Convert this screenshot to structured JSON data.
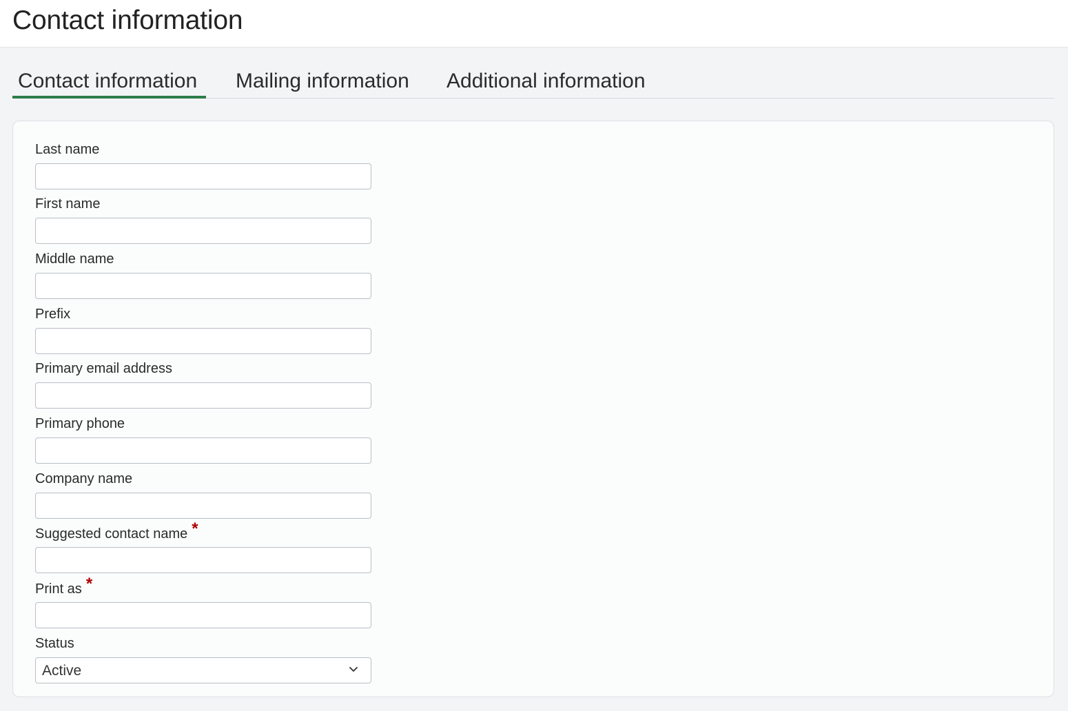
{
  "header": {
    "title": "Contact information"
  },
  "tabs": [
    {
      "label": "Contact information",
      "active": true
    },
    {
      "label": "Mailing information",
      "active": false
    },
    {
      "label": "Additional information",
      "active": false
    }
  ],
  "form": {
    "fields": [
      {
        "label": "Last name",
        "value": "",
        "required": false
      },
      {
        "label": "First name",
        "value": "",
        "required": false
      },
      {
        "label": "Middle name",
        "value": "",
        "required": false
      },
      {
        "label": "Prefix",
        "value": "",
        "required": false
      },
      {
        "label": "Primary email address",
        "value": "",
        "required": false
      },
      {
        "label": "Primary phone",
        "value": "",
        "required": false
      },
      {
        "label": "Company name",
        "value": "",
        "required": false
      },
      {
        "label": "Suggested contact name",
        "value": "",
        "required": true
      },
      {
        "label": "Print as",
        "value": "",
        "required": true
      }
    ],
    "status": {
      "label": "Status",
      "selected": "Active",
      "icon": "chevron-down-icon"
    },
    "required_marker": "*"
  },
  "colors": {
    "accent": "#2e7d4a",
    "required": "#b00000",
    "background": "#f3f4f6",
    "card": "#fbfcfc"
  }
}
